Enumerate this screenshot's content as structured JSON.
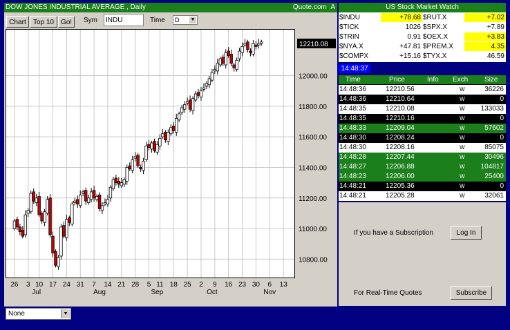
{
  "header": {
    "title": "DOW JONES INDUSTRIAL AVERAGE  , Daily",
    "brand": "Quote.com",
    "brand_suffix": "A"
  },
  "toolbar": {
    "chart_label": "Chart",
    "top10_label": "Top 10",
    "go_label": "Go!",
    "sym_label": "Sym",
    "sym_value": "INDU",
    "time_label": "Time",
    "time_value": "D"
  },
  "bottom_select": {
    "value": "None"
  },
  "market_watch": {
    "title": "US Stock Market Watch",
    "rows": [
      {
        "sym1": "$INDU",
        "val1": "+78.68",
        "hl1": true,
        "sym2": "$RUT.X",
        "val2": "+7.02",
        "hl2": true
      },
      {
        "sym1": "$TICK",
        "val1": "1026",
        "hl1": false,
        "sym2": "$SPX.X",
        "val2": "+7.89",
        "hl2": false
      },
      {
        "sym1": "$TRIN",
        "val1": "0.91",
        "hl1": false,
        "sym2": "$OEX.X",
        "val2": "+3.83",
        "hl2": true
      },
      {
        "sym1": "$NYA.X",
        "val1": "+47.81",
        "hl1": false,
        "sym2": "$PREM.X",
        "val2": "4.35",
        "hl2": true
      },
      {
        "sym1": "$COMPX",
        "val1": "+15.16",
        "hl1": false,
        "sym2": "$TYX.X",
        "val2": "46.59",
        "hl2": false
      }
    ]
  },
  "clock": "14:48:37",
  "time_sales": {
    "headers": [
      "Time",
      "Price",
      "Info",
      "Exch",
      "Size"
    ],
    "rows": [
      {
        "time": "14:48:36",
        "price": "12210.56",
        "exch": "W",
        "size": "36226",
        "style": "white"
      },
      {
        "time": "14:48:36",
        "price": "12210.64",
        "exch": "W",
        "size": "0",
        "style": "black"
      },
      {
        "time": "14:48:35",
        "price": "12210.08",
        "exch": "W",
        "size": "133033",
        "style": "white"
      },
      {
        "time": "14:48:35",
        "price": "12210.16",
        "exch": "W",
        "size": "0",
        "style": "black"
      },
      {
        "time": "14:48:33",
        "price": "12209.04",
        "exch": "W",
        "size": "57602",
        "style": "green"
      },
      {
        "time": "14:48:30",
        "price": "12208.24",
        "exch": "W",
        "size": "0",
        "style": "black"
      },
      {
        "time": "14:48:30",
        "price": "12208.16",
        "exch": "W",
        "size": "85075",
        "style": "white"
      },
      {
        "time": "14:48:28",
        "price": "12207.44",
        "exch": "W",
        "size": "30496",
        "style": "green"
      },
      {
        "time": "14:48:27",
        "price": "12206.88",
        "exch": "W",
        "size": "104817",
        "style": "green"
      },
      {
        "time": "14:48:23",
        "price": "12206.00",
        "exch": "W",
        "size": "25400",
        "style": "green"
      },
      {
        "time": "14:48:21",
        "price": "12205.36",
        "exch": "W",
        "size": "0",
        "style": "black"
      },
      {
        "time": "14:48:21",
        "price": "12205.28",
        "exch": "W",
        "size": "32061",
        "style": "white"
      }
    ]
  },
  "subscription": {
    "text": "If you have a Subscription",
    "login_label": "Log In",
    "realtime_text": "For Real-Time Quotes",
    "subscribe_label": "Subscribe"
  },
  "colors": {
    "accent_green": "#1b7f1b",
    "highlight_yellow": "#ffff00",
    "candle_up": "#ffffff",
    "candle_down": "#cc0000",
    "clock_bg": "#0000ff"
  },
  "chart_data": {
    "type": "candlestick",
    "current_price_label": "12210.08",
    "current_price": 12210.08,
    "ylim": [
      10680,
      12300
    ],
    "y_ticks": [
      {
        "value": 12000,
        "label": "12000.00"
      },
      {
        "value": 11800,
        "label": "11800.00"
      },
      {
        "value": 11600,
        "label": "11600.00"
      },
      {
        "value": 11400,
        "label": "11400.00"
      },
      {
        "value": 11200,
        "label": "11200.00"
      },
      {
        "value": 11000,
        "label": "11000.00"
      },
      {
        "value": 10800,
        "label": "10800.00"
      }
    ],
    "x_tick_labels": [
      {
        "day": 0,
        "label": "26"
      },
      {
        "day": 5,
        "label": "3"
      },
      {
        "day": 9,
        "label": "10"
      },
      {
        "day": 14,
        "label": "17"
      },
      {
        "day": 19,
        "label": "24"
      },
      {
        "day": 24,
        "label": "31"
      },
      {
        "day": 29,
        "label": "7"
      },
      {
        "day": 34,
        "label": "14"
      },
      {
        "day": 39,
        "label": "21"
      },
      {
        "day": 44,
        "label": "28"
      },
      {
        "day": 49,
        "label": "5"
      },
      {
        "day": 53,
        "label": "11"
      },
      {
        "day": 58,
        "label": "18"
      },
      {
        "day": 63,
        "label": "25"
      },
      {
        "day": 68,
        "label": "2"
      },
      {
        "day": 73,
        "label": "9"
      },
      {
        "day": 78,
        "label": "16"
      },
      {
        "day": 83,
        "label": "23"
      },
      {
        "day": 88,
        "label": "30"
      },
      {
        "day": 93,
        "label": "6"
      },
      {
        "day": 98,
        "label": "13"
      }
    ],
    "month_labels": [
      {
        "day": 8,
        "label": "Jul"
      },
      {
        "day": 31,
        "label": "Aug"
      },
      {
        "day": 52,
        "label": "Sep"
      },
      {
        "day": 72,
        "label": "Oct"
      },
      {
        "day": 93,
        "label": "Nov"
      }
    ],
    "xlim": [
      -3,
      102
    ],
    "closes": [
      11050,
      11010,
      10980,
      10950,
      11090,
      11120,
      11230,
      11180,
      11200,
      11090,
      11050,
      11110,
      11190,
      10960,
      10840,
      10760,
      10810,
      11010,
      10950,
      11060,
      11040,
      11160,
      11180,
      11160,
      11220,
      11240,
      11180,
      11200,
      11240,
      11200,
      11210,
      11130,
      11150,
      11170,
      11190,
      11270,
      11320,
      11300,
      11290,
      11300,
      11320,
      11400,
      11390,
      11450,
      11470,
      11410,
      11390,
      11440,
      11540,
      11530,
      11560,
      11510,
      11550,
      11590,
      11620,
      11580,
      11630,
      11660,
      11640,
      11720,
      11750,
      11790,
      11810,
      11830,
      11780,
      11850,
      11880,
      11870,
      11900,
      11920,
      11950,
      11980,
      12020,
      12040,
      12080,
      12110,
      12080,
      12150,
      12130,
      12080,
      12050,
      12100,
      12160,
      12190,
      12210,
      12170,
      12150,
      12210,
      12190,
      12210,
      12220
    ],
    "opens": [
      11000,
      11060,
      11010,
      10990,
      10960,
      11100,
      11110,
      11240,
      11170,
      11210,
      11100,
      11040,
      11100,
      11200,
      10950,
      10850,
      10750,
      10820,
      11020,
      10940,
      11070,
      11030,
      11170,
      11190,
      11150,
      11230,
      11250,
      11170,
      11190,
      11250,
      11190,
      11220,
      11120,
      11160,
      11160,
      11200,
      11260,
      11330,
      11310,
      11280,
      11290,
      11310,
      11410,
      11380,
      11460,
      11480,
      11400,
      11380,
      11450,
      11550,
      11520,
      11570,
      11500,
      11540,
      11600,
      11630,
      11570,
      11620,
      11670,
      11630,
      11710,
      11760,
      11780,
      11820,
      11840,
      11770,
      11840,
      11890,
      11860,
      11910,
      11930,
      11940,
      11970,
      12030,
      12030,
      12070,
      12120,
      12070,
      12160,
      12140,
      12070,
      12040,
      12110,
      12150,
      12200,
      12220,
      12160,
      12140,
      12200,
      12200,
      12210
    ]
  }
}
